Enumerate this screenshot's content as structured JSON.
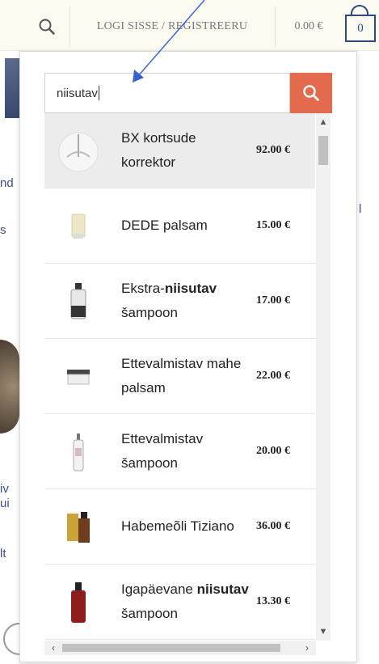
{
  "header": {
    "login_label": "LOGI SISSE / REGISTREERU",
    "cart_total": "0.00 €",
    "cart_count": "0"
  },
  "search": {
    "query": "niisutav",
    "accent_color": "#e36b4d"
  },
  "background_fragments": [
    "nd",
    "s",
    "l",
    "iv",
    "ui",
    "lt"
  ],
  "results": [
    {
      "name_parts": [
        {
          "t": "BX kortsude korrektor",
          "b": false
        }
      ],
      "price": "92.00 €",
      "image": "round-white-device"
    },
    {
      "name_parts": [
        {
          "t": "DEDE palsam",
          "b": false
        }
      ],
      "price": "15.00 €",
      "image": "cream-tube"
    },
    {
      "name_parts": [
        {
          "t": "Ekstra-",
          "b": false
        },
        {
          "t": "niisutav",
          "b": true
        },
        {
          "t": " šampoon",
          "b": false
        }
      ],
      "price": "17.00 €",
      "image": "clear-bottle"
    },
    {
      "name_parts": [
        {
          "t": "Ettevalmistav mahe palsam",
          "b": false
        }
      ],
      "price": "22.00 €",
      "image": "jar"
    },
    {
      "name_parts": [
        {
          "t": "Ettevalmistav šampoon",
          "b": false
        }
      ],
      "price": "20.00 €",
      "image": "slim-bottle"
    },
    {
      "name_parts": [
        {
          "t": "Habemeõli Tiziano",
          "b": false
        }
      ],
      "price": "36.00 €",
      "image": "oil-bottles"
    },
    {
      "name_parts": [
        {
          "t": "Igapäevane ",
          "b": false
        },
        {
          "t": "niisutav",
          "b": true
        },
        {
          "t": " šampoon",
          "b": false
        }
      ],
      "price": "13.30 €",
      "image": "red-bottle"
    }
  ]
}
